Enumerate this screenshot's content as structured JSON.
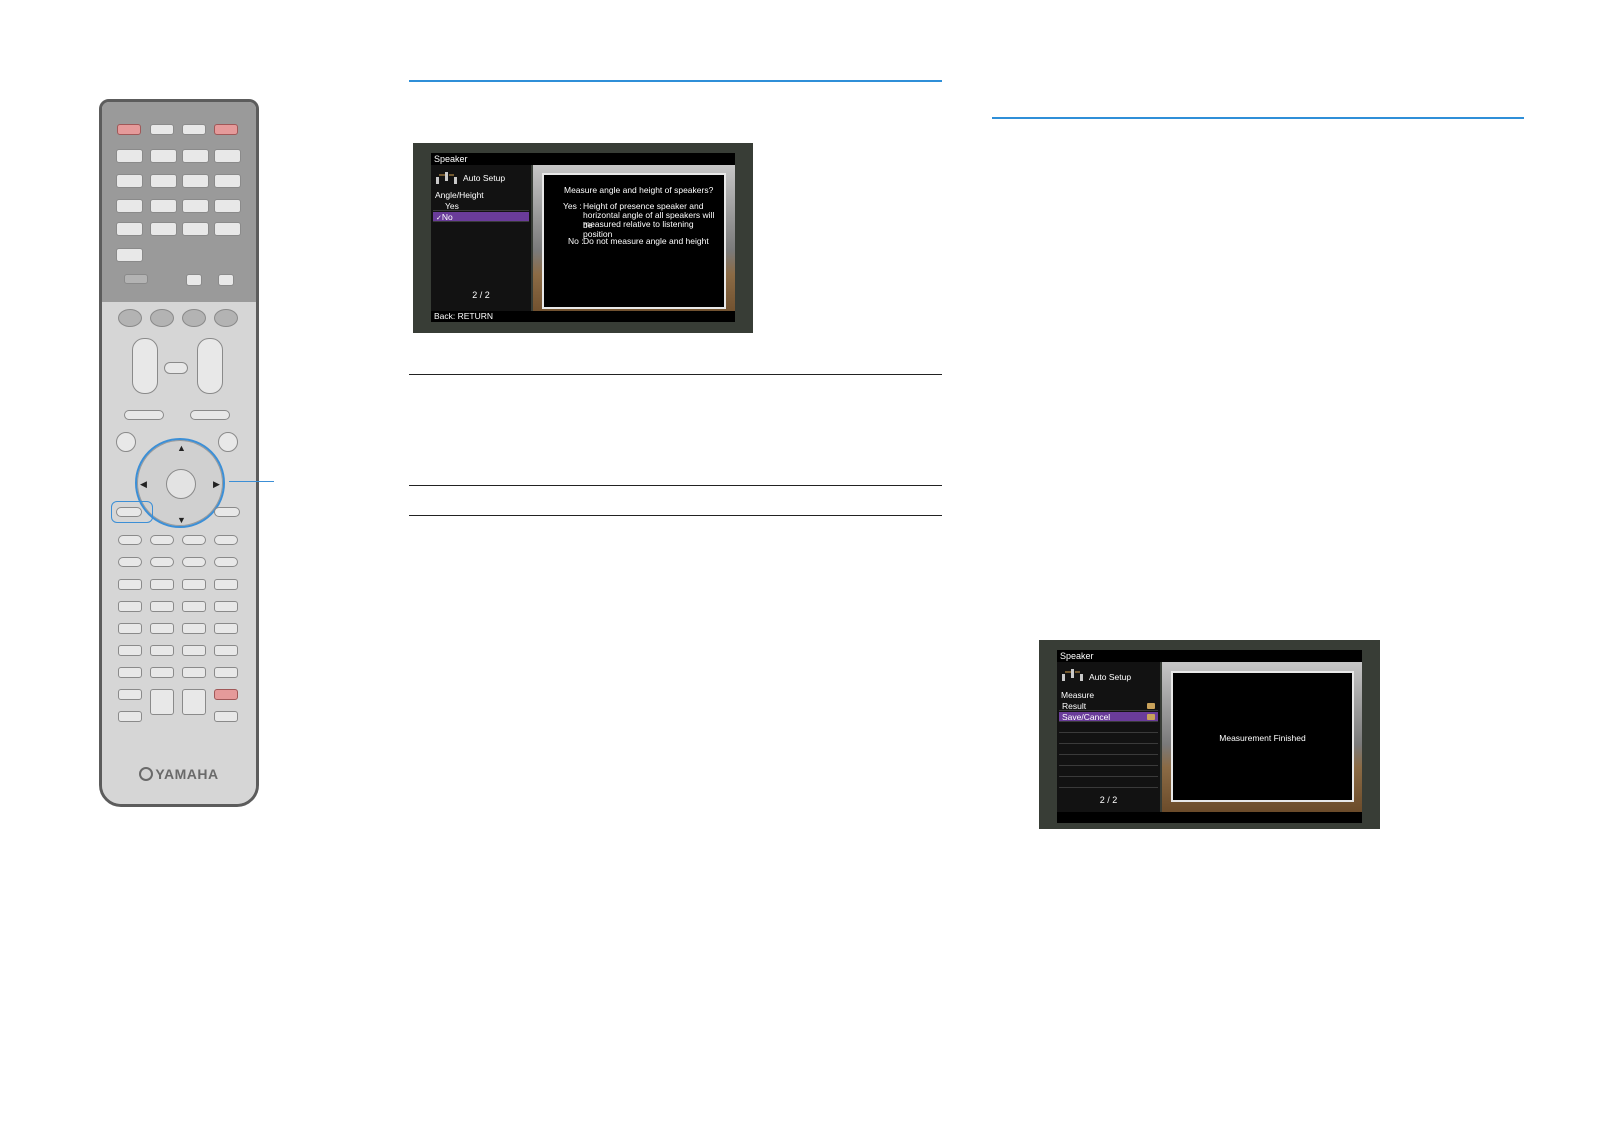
{
  "remote": {
    "brand": "YAMAHA"
  },
  "screen1": {
    "title": "Speaker",
    "menu_header": "Auto Setup",
    "submenu": "Angle/Height",
    "options": [
      "Yes",
      "No"
    ],
    "selected_option": "No",
    "check_mark": "✓",
    "pager": "2 / 2",
    "footer": "Back: RETURN",
    "message": "Measure angle and height of speakers?",
    "yes_key": "Yes :",
    "yes_text": [
      "Height of presence speaker and",
      "horizontal angle of all speakers will be",
      "measured relative to listening position"
    ],
    "no_key": "No :",
    "no_text": "Do not measure angle and height"
  },
  "screen2": {
    "title": "Speaker",
    "menu_header": "Auto Setup",
    "submenu": "Measure",
    "items": [
      "Result",
      "Save/Cancel"
    ],
    "selected_item": "Save/Cancel",
    "pager": "2 / 2",
    "message": "Measurement Finished"
  },
  "colors": {
    "accent_blue": "#2f8fd8",
    "selection_purple": "#6a3c9a"
  }
}
